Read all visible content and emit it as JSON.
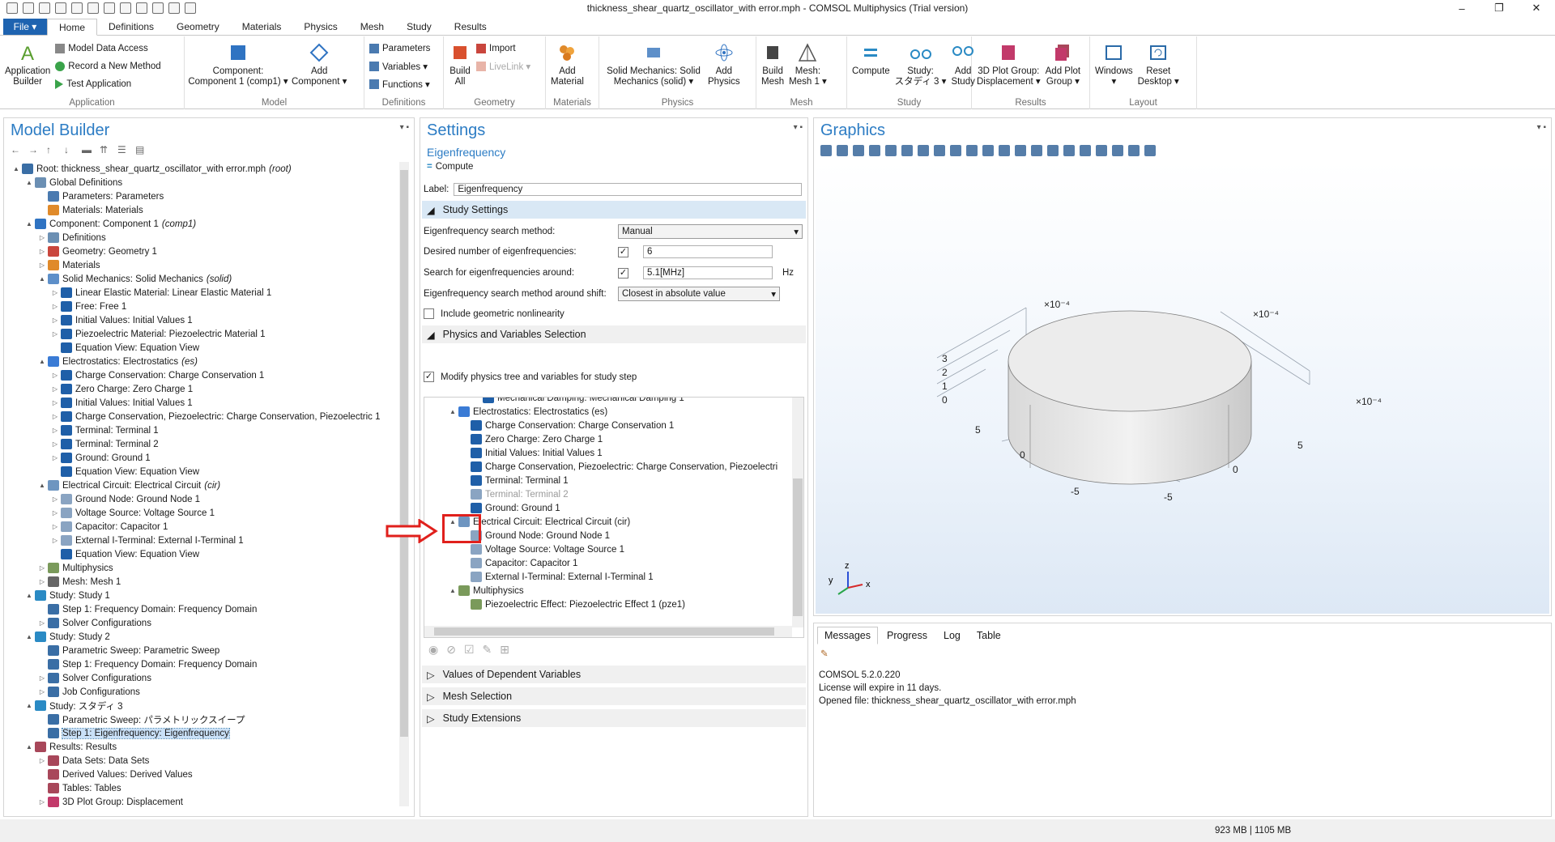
{
  "window": {
    "title": "thickness_shear_quartz_oscillator_with error.mph - COMSOL Multiphysics (Trial version)",
    "controls": [
      "–",
      "❐",
      "✕"
    ]
  },
  "ribbon_tabs": [
    "Home",
    "Definitions",
    "Geometry",
    "Materials",
    "Physics",
    "Mesh",
    "Study",
    "Results"
  ],
  "file_label": "File ▾",
  "ribbon": {
    "application": {
      "group": "Application",
      "builder": "Application\nBuilder",
      "model_data_access": "Model Data Access",
      "record_method": "Record a New Method",
      "test_application": "Test Application"
    },
    "model": {
      "group": "Model",
      "component": "Component:\nComponent 1 (comp1) ▾",
      "add_component": "Add\nComponent ▾"
    },
    "definitions": {
      "group": "Definitions",
      "parameters": "Parameters",
      "variables": "Variables ▾",
      "functions": "Functions ▾"
    },
    "geometry": {
      "group": "Geometry",
      "build_all": "Build\nAll",
      "import": "Import",
      "livelink": "LiveLink ▾"
    },
    "materials": {
      "group": "Materials",
      "add_material": "Add\nMaterial"
    },
    "physics": {
      "group": "Physics",
      "solid_mechanics": "Solid Mechanics: Solid\nMechanics (solid) ▾",
      "add_physics": "Add\nPhysics"
    },
    "mesh": {
      "group": "Mesh",
      "build_mesh": "Build\nMesh",
      "mesh1": "Mesh:\nMesh 1 ▾"
    },
    "study": {
      "group": "Study",
      "compute": "Compute",
      "study3": "Study:\nスタディ 3 ▾",
      "add_study": "Add\nStudy"
    },
    "results": {
      "group": "Results",
      "plot_group": "3D Plot Group:\nDisplacement ▾",
      "add_plot": "Add Plot\nGroup ▾"
    },
    "layout": {
      "group": "Layout",
      "windows": "Windows\n▾",
      "reset": "Reset\nDesktop ▾"
    }
  },
  "model_builder": {
    "title": "Model Builder",
    "tree": [
      {
        "d": 0,
        "tw": "▲",
        "label": "Root: thickness_shear_quartz_oscillator_with error.mph",
        "tag": "(root)",
        "c": "#3a6ea5"
      },
      {
        "d": 1,
        "tw": "▲",
        "label": "Global Definitions",
        "c": "#6b8fb3"
      },
      {
        "d": 2,
        "tw": "",
        "label": "Parameters: Parameters",
        "c": "#4a7ab0"
      },
      {
        "d": 2,
        "tw": "",
        "label": "Materials: Materials",
        "c": "#e08a2a"
      },
      {
        "d": 1,
        "tw": "▲",
        "label": "Component: Component 1",
        "tag": "(comp1)",
        "c": "#2f73c2"
      },
      {
        "d": 2,
        "tw": "▷",
        "label": "Definitions",
        "c": "#6b8fb3"
      },
      {
        "d": 2,
        "tw": "▷",
        "label": "Geometry: Geometry 1",
        "c": "#c9463d"
      },
      {
        "d": 2,
        "tw": "▷",
        "label": "Materials",
        "c": "#e08a2a"
      },
      {
        "d": 2,
        "tw": "▲",
        "label": "Solid Mechanics: Solid Mechanics",
        "tag": "(solid)",
        "c": "#5d8fc9"
      },
      {
        "d": 3,
        "tw": "▷",
        "label": "Linear Elastic Material: Linear Elastic Material 1",
        "c": "#1f5fa8"
      },
      {
        "d": 3,
        "tw": "▷",
        "label": "Free: Free 1",
        "c": "#1f5fa8"
      },
      {
        "d": 3,
        "tw": "▷",
        "label": "Initial Values: Initial Values 1",
        "c": "#1f5fa8"
      },
      {
        "d": 3,
        "tw": "▷",
        "label": "Piezoelectric Material: Piezoelectric Material 1",
        "c": "#1f5fa8"
      },
      {
        "d": 3,
        "tw": "",
        "label": "Equation View: Equation View",
        "c": "#1f5fa8"
      },
      {
        "d": 2,
        "tw": "▲",
        "label": "Electrostatics: Electrostatics",
        "tag": "(es)",
        "c": "#3a7bd5"
      },
      {
        "d": 3,
        "tw": "▷",
        "label": "Charge Conservation: Charge Conservation 1",
        "c": "#1f5fa8"
      },
      {
        "d": 3,
        "tw": "▷",
        "label": "Zero Charge: Zero Charge 1",
        "c": "#1f5fa8"
      },
      {
        "d": 3,
        "tw": "▷",
        "label": "Initial Values: Initial Values 1",
        "c": "#1f5fa8"
      },
      {
        "d": 3,
        "tw": "▷",
        "label": "Charge Conservation, Piezoelectric: Charge Conservation, Piezoelectric 1",
        "c": "#1f5fa8"
      },
      {
        "d": 3,
        "tw": "▷",
        "label": "Terminal: Terminal 1",
        "c": "#1f5fa8"
      },
      {
        "d": 3,
        "tw": "▷",
        "label": "Terminal: Terminal 2",
        "c": "#1f5fa8"
      },
      {
        "d": 3,
        "tw": "▷",
        "label": "Ground: Ground 1",
        "c": "#1f5fa8"
      },
      {
        "d": 3,
        "tw": "",
        "label": "Equation View: Equation View",
        "c": "#1f5fa8"
      },
      {
        "d": 2,
        "tw": "▲",
        "label": "Electrical Circuit: Electrical Circuit",
        "tag": "(cir)",
        "c": "#6e95c0"
      },
      {
        "d": 3,
        "tw": "▷",
        "label": "Ground Node: Ground Node 1",
        "c": "#8aa4c2"
      },
      {
        "d": 3,
        "tw": "▷",
        "label": "Voltage Source: Voltage Source 1",
        "c": "#8aa4c2"
      },
      {
        "d": 3,
        "tw": "▷",
        "label": "Capacitor: Capacitor 1",
        "c": "#8aa4c2"
      },
      {
        "d": 3,
        "tw": "▷",
        "label": "External I-Terminal: External I-Terminal 1",
        "c": "#8aa4c2"
      },
      {
        "d": 3,
        "tw": "",
        "label": "Equation View: Equation View",
        "c": "#1f5fa8"
      },
      {
        "d": 2,
        "tw": "▷",
        "label": "Multiphysics",
        "c": "#7a9a5b"
      },
      {
        "d": 2,
        "tw": "▷",
        "label": "Mesh: Mesh 1",
        "c": "#666666"
      },
      {
        "d": 1,
        "tw": "▲",
        "label": "Study: Study 1",
        "c": "#2a8ac4"
      },
      {
        "d": 2,
        "tw": "",
        "label": "Step 1: Frequency Domain: Frequency Domain",
        "c": "#3a6ea5"
      },
      {
        "d": 2,
        "tw": "▷",
        "label": "Solver Configurations",
        "c": "#3a6ea5"
      },
      {
        "d": 1,
        "tw": "▲",
        "label": "Study: Study 2",
        "c": "#2a8ac4"
      },
      {
        "d": 2,
        "tw": "",
        "label": "Parametric Sweep: Parametric Sweep",
        "c": "#3a6ea5"
      },
      {
        "d": 2,
        "tw": "",
        "label": "  Step 1: Frequency Domain: Frequency Domain",
        "c": "#3a6ea5"
      },
      {
        "d": 2,
        "tw": "▷",
        "label": "Solver Configurations",
        "c": "#3a6ea5"
      },
      {
        "d": 2,
        "tw": "▷",
        "label": "Job Configurations",
        "c": "#3a6ea5"
      },
      {
        "d": 1,
        "tw": "▲",
        "label": "Study: スタディ 3",
        "c": "#2a8ac4"
      },
      {
        "d": 2,
        "tw": "",
        "label": "Parametric Sweep: パラメトリックスイープ",
        "c": "#3a6ea5"
      },
      {
        "d": 2,
        "tw": "",
        "label": "  Step 1: Eigenfrequency: Eigenfrequency",
        "c": "#3a6ea5",
        "sel": true
      },
      {
        "d": 1,
        "tw": "▲",
        "label": "Results: Results",
        "c": "#a8475a"
      },
      {
        "d": 2,
        "tw": "▷",
        "label": "Data Sets: Data Sets",
        "c": "#a8475a"
      },
      {
        "d": 2,
        "tw": "",
        "label": "Derived Values: Derived Values",
        "c": "#a8475a"
      },
      {
        "d": 2,
        "tw": "",
        "label": "Tables: Tables",
        "c": "#a8475a"
      },
      {
        "d": 2,
        "tw": "▷",
        "label": "3D Plot Group: Displacement",
        "c": "#c23a6a"
      }
    ]
  },
  "settings": {
    "title": "Settings",
    "subtitle": "Eigenfrequency",
    "compute": "Compute",
    "label_caption": "Label:",
    "label_value": "Eigenfrequency",
    "study_settings": "Study Settings",
    "search_method_label": "Eigenfrequency search method:",
    "search_method_value": "Manual",
    "num_eig_label": "Desired number of eigenfrequencies:",
    "num_eig_value": "6",
    "search_around_label": "Search for eigenfrequencies around:",
    "search_around_value": "5.1[MHz]",
    "search_around_unit": "Hz",
    "shift_label": "Eigenfrequency search method around shift:",
    "shift_value": "Closest in absolute value",
    "geom_nonlin": "Include geometric nonlinearity",
    "physics_selection": "Physics and Variables Selection",
    "modify_tree": "Modify physics tree and variables for study step",
    "ptree": [
      {
        "d": 4,
        "tw": "",
        "label": "Mechanical Damping: Mechanical Damping 1",
        "c": "#1f5fa8"
      },
      {
        "d": 2,
        "tw": "▲",
        "label": "Electrostatics: Electrostatics (es)",
        "c": "#3a7bd5"
      },
      {
        "d": 3,
        "tw": "",
        "label": "Charge Conservation: Charge Conservation 1",
        "c": "#1f5fa8"
      },
      {
        "d": 3,
        "tw": "",
        "label": "Zero Charge: Zero Charge 1",
        "c": "#1f5fa8"
      },
      {
        "d": 3,
        "tw": "",
        "label": "Initial Values: Initial Values 1",
        "c": "#1f5fa8"
      },
      {
        "d": 3,
        "tw": "",
        "label": "Charge Conservation, Piezoelectric: Charge Conservation, Piezoelectri",
        "c": "#1f5fa8"
      },
      {
        "d": 3,
        "tw": "",
        "label": "Terminal: Terminal 1",
        "c": "#1f5fa8"
      },
      {
        "d": 3,
        "tw": "",
        "label": "Terminal: Terminal 2",
        "c": "#8aa4c2",
        "dim": true
      },
      {
        "d": 3,
        "tw": "",
        "label": "Ground: Ground 1",
        "c": "#1f5fa8"
      },
      {
        "d": 2,
        "tw": "▲",
        "label": "Electrical Circuit: Electrical Circuit (cir)",
        "c": "#6e95c0"
      },
      {
        "d": 3,
        "tw": "",
        "label": "Ground Node: Ground Node 1",
        "c": "#8aa4c2"
      },
      {
        "d": 3,
        "tw": "",
        "label": "Voltage Source: Voltage Source 1",
        "c": "#8aa4c2"
      },
      {
        "d": 3,
        "tw": "",
        "label": "Capacitor: Capacitor 1",
        "c": "#8aa4c2"
      },
      {
        "d": 3,
        "tw": "",
        "label": "External I-Terminal: External I-Terminal 1",
        "c": "#8aa4c2"
      },
      {
        "d": 2,
        "tw": "▲",
        "label": "Multiphysics",
        "c": "#7a9a5b"
      },
      {
        "d": 3,
        "tw": "",
        "label": "Piezoelectric Effect: Piezoelectric Effect 1 (pze1)",
        "c": "#7a9a5b"
      }
    ],
    "values_dep": "Values of Dependent Variables",
    "mesh_selection": "Mesh Selection",
    "study_extensions": "Study Extensions"
  },
  "graphics": {
    "title": "Graphics",
    "axis_scale": "×10⁻⁴",
    "ticks_z": [
      "3",
      "2",
      "1",
      "0"
    ],
    "tick_labels": {
      "t5a": "5",
      "t0a": "0",
      "t_5a": "-5",
      "t5b": "5",
      "t0b": "0",
      "t_5b": "-5"
    },
    "triad": {
      "x": "x",
      "y": "y",
      "z": "z"
    }
  },
  "messages": {
    "tabs": [
      "Messages",
      "Progress",
      "Log",
      "Table"
    ],
    "lines": [
      "COMSOL 5.2.0.220",
      "License will expire in 11 days.",
      "Opened file: thickness_shear_quartz_oscillator_with error.mph"
    ]
  },
  "status": {
    "memory": "923 MB | 1105 MB"
  },
  "colors": {
    "accent": "#2c7cc4",
    "file": "#1e63b0",
    "highlight": "#e0201c"
  }
}
